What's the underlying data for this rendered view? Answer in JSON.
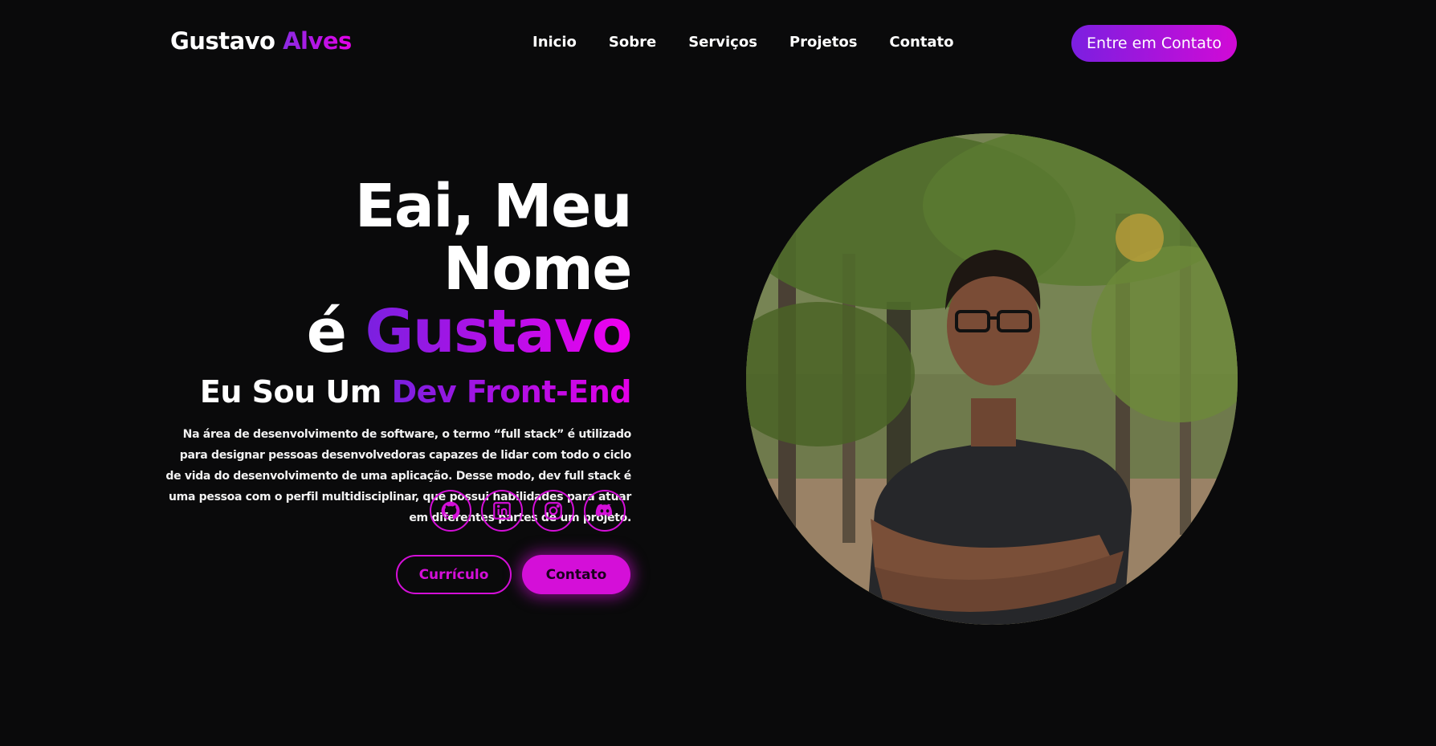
{
  "header": {
    "logo_first": "Gustavo",
    "logo_second": "Alves",
    "nav": [
      "Inicio",
      "Sobre",
      "Serviços",
      "Projetos",
      "Contato"
    ],
    "cta_label": "Entre em Contato"
  },
  "hero": {
    "title_line1": "Eai, Meu Nome",
    "title_line2_prefix": "é ",
    "title_line2_accent": "Gustavo",
    "subtitle_prefix": "Eu Sou Um ",
    "subtitle_accent": "Dev Front-End",
    "description": "Na área de desenvolvimento de software, o termo “full stack” é utilizado para designar pessoas desenvolvedoras capazes de lidar com todo o ciclo de vida do desenvolvimento de uma aplicação. Desse modo, dev full stack é uma pessoa com o perfil multidisciplinar, que possui habilidades para atuar em diferentes partes de um projeto.",
    "socials": [
      "github-icon",
      "linkedin-icon",
      "instagram-icon",
      "discord-icon"
    ],
    "btn_cv": "Currículo",
    "btn_contact": "Contato"
  },
  "colors": {
    "background": "#0a0a0b",
    "accent": "#d40fd8",
    "accent_purple": "#7a20e0"
  }
}
